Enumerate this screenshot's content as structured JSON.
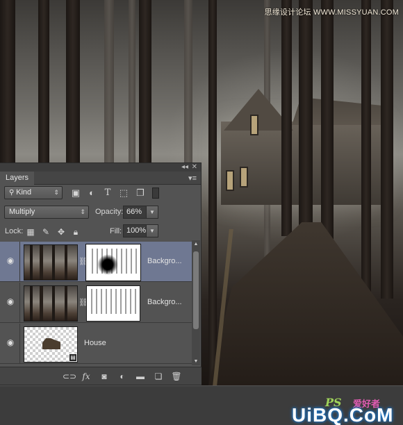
{
  "watermark_top": "思缘设计论坛  WWW.MISSYUAN.COM",
  "logo": {
    "ps_text": "PS",
    "cn_text": "爱好者",
    "main_text": "UiBQ.CoM"
  },
  "panel": {
    "title": "Layers",
    "collapse_icon": "double-chevron-icon",
    "close_icon": "close-icon",
    "menu_icon": "panel-menu-icon",
    "filter": {
      "kind_label": "Kind",
      "icons": [
        "image-filter-icon",
        "adjustment-filter-icon",
        "type-filter-icon",
        "shape-filter-icon",
        "smart-object-filter-icon",
        "filter-toggle-icon"
      ]
    },
    "blend_mode": "Multiply",
    "opacity_label": "Opacity:",
    "opacity_value": "66%",
    "lock_label": "Lock:",
    "fill_label": "Fill:",
    "fill_value": "100%",
    "layers": [
      {
        "name": "Backgro...",
        "selected": true,
        "has_mask": true
      },
      {
        "name": "Backgro...",
        "selected": false,
        "has_mask": true
      },
      {
        "name": "House",
        "selected": false,
        "has_mask": false
      }
    ],
    "footer_icons": [
      "link-icon",
      "fx-icon",
      "mask-icon",
      "adjustment-icon",
      "folder-icon",
      "new-layer-icon",
      "trash-icon"
    ],
    "footer_fx": "fx"
  }
}
